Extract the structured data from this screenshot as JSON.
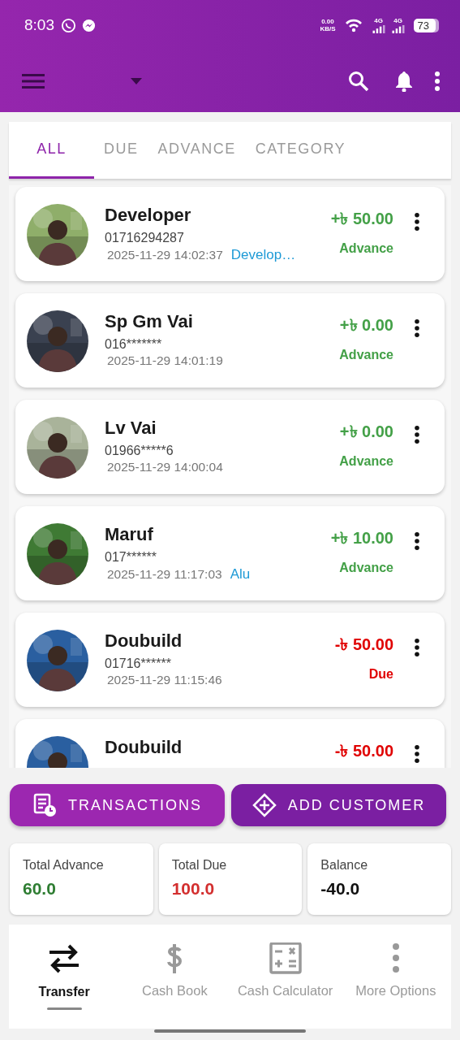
{
  "status_bar": {
    "time": "8:03",
    "speed": [
      "0.00",
      "KB/S"
    ],
    "networks": [
      "4G",
      "4G"
    ],
    "battery": "73"
  },
  "tabs": [
    {
      "label": "ALL",
      "selected": true
    },
    {
      "label": "DUE",
      "selected": false
    },
    {
      "label": "ADVANCE",
      "selected": false
    },
    {
      "label": "CATEGORY",
      "selected": false
    }
  ],
  "customers": [
    {
      "name": "Developer",
      "phone": "01716294287",
      "time": "2025-11-29 14:02:37",
      "tag": "Develop…",
      "amount": "+৳ 50.00",
      "status": "Advance",
      "kind": "advance"
    },
    {
      "name": "Sp Gm Vai",
      "phone": "016*******",
      "time": "2025-11-29 14:01:19",
      "amount": "+৳ 0.00",
      "status": "Advance",
      "kind": "advance"
    },
    {
      "name": "Lv Vai",
      "phone": "01966*****6",
      "time": "2025-11-29 14:00:04",
      "amount": "+৳ 0.00",
      "status": "Advance",
      "kind": "advance"
    },
    {
      "name": "Maruf",
      "phone": "017******",
      "time": "2025-11-29 11:17:03",
      "tag": "Alu",
      "amount": "+৳ 10.00",
      "status": "Advance",
      "kind": "advance"
    },
    {
      "name": "Doubuild",
      "phone": "01716******",
      "time": "2025-11-29 11:15:46",
      "amount": "-৳ 50.00",
      "status": "Due",
      "kind": "due"
    },
    {
      "name": "Doubuild",
      "amount": "-৳ 50.00",
      "kind": "due"
    }
  ],
  "actions": [
    {
      "label": "TRANSACTIONS",
      "kind": "transactions"
    },
    {
      "label": "ADD CUSTOMER",
      "kind": "add"
    }
  ],
  "totals": [
    {
      "label": "Total Advance",
      "value": "60.0",
      "kind": "advance"
    },
    {
      "label": "Total Due",
      "value": "100.0",
      "kind": "due"
    },
    {
      "label": "Balance",
      "value": "-40.0",
      "kind": "balance"
    }
  ],
  "bottom_nav": [
    {
      "label": "Transfer",
      "kind": "transfer",
      "selected": true
    },
    {
      "label": "Cash Book",
      "kind": "cash",
      "selected": false
    },
    {
      "label": "Cash Calculator",
      "kind": "calc",
      "selected": false
    },
    {
      "label": "More Options",
      "kind": "more",
      "selected": false
    }
  ]
}
